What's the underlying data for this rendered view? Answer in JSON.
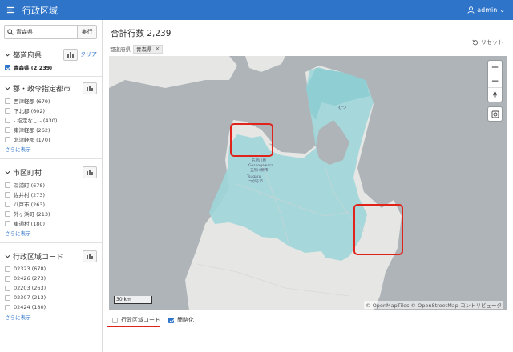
{
  "header": {
    "title": "行政区域",
    "user": "admin"
  },
  "search": {
    "value": "青森県",
    "run_label": "実行"
  },
  "facets": [
    {
      "title": "都道府県",
      "clear_label": "クリア",
      "options": [
        {
          "label": "青森県 (2,239)",
          "checked": true
        }
      ]
    },
    {
      "title": "郡・政令指定都市",
      "options": [
        {
          "label": "西津軽郡 (679)"
        },
        {
          "label": "下北郡 (602)"
        },
        {
          "label": "- 指定なし - (430)"
        },
        {
          "label": "東津軽郡 (262)"
        },
        {
          "label": "北津軽郡 (170)"
        }
      ],
      "more_label": "さらに表示"
    },
    {
      "title": "市区町村",
      "options": [
        {
          "label": "深浦町 (678)"
        },
        {
          "label": "佐井村 (273)"
        },
        {
          "label": "八戸市 (263)"
        },
        {
          "label": "外ヶ浜町 (213)"
        },
        {
          "label": "東通村 (180)"
        }
      ],
      "more_label": "さらに表示"
    },
    {
      "title": "行政区域コード",
      "options": [
        {
          "label": "02323 (678)"
        },
        {
          "label": "02426 (273)"
        },
        {
          "label": "02203 (263)"
        },
        {
          "label": "02307 (213)"
        },
        {
          "label": "02424 (180)"
        }
      ],
      "more_label": "さらに表示"
    }
  ],
  "main": {
    "total": "合計行数 2,239",
    "reset_label": "リセット",
    "chip_label": "都道府県",
    "chip_value": "青森県"
  },
  "map": {
    "scale_label": "30 km",
    "attribution": "© OpenMapTiles  © OpenStreetMap コントリビュータ",
    "place_labels": [
      "むつ",
      "五所川原",
      "Goshogawara",
      "五所川原市",
      "Tsugaru",
      "つがる市"
    ],
    "zoom_in": "+",
    "zoom_out": "−"
  },
  "legend": {
    "code_label": "行政区域コード",
    "simplify_label": "簡略化",
    "simplify_checked": true
  },
  "colors": {
    "header": "#2e74c9",
    "region_fill": "#9fd6d9",
    "highlight": "#e0241b",
    "map_bg": "#aeb4b8",
    "land": "#e6e6e4"
  }
}
